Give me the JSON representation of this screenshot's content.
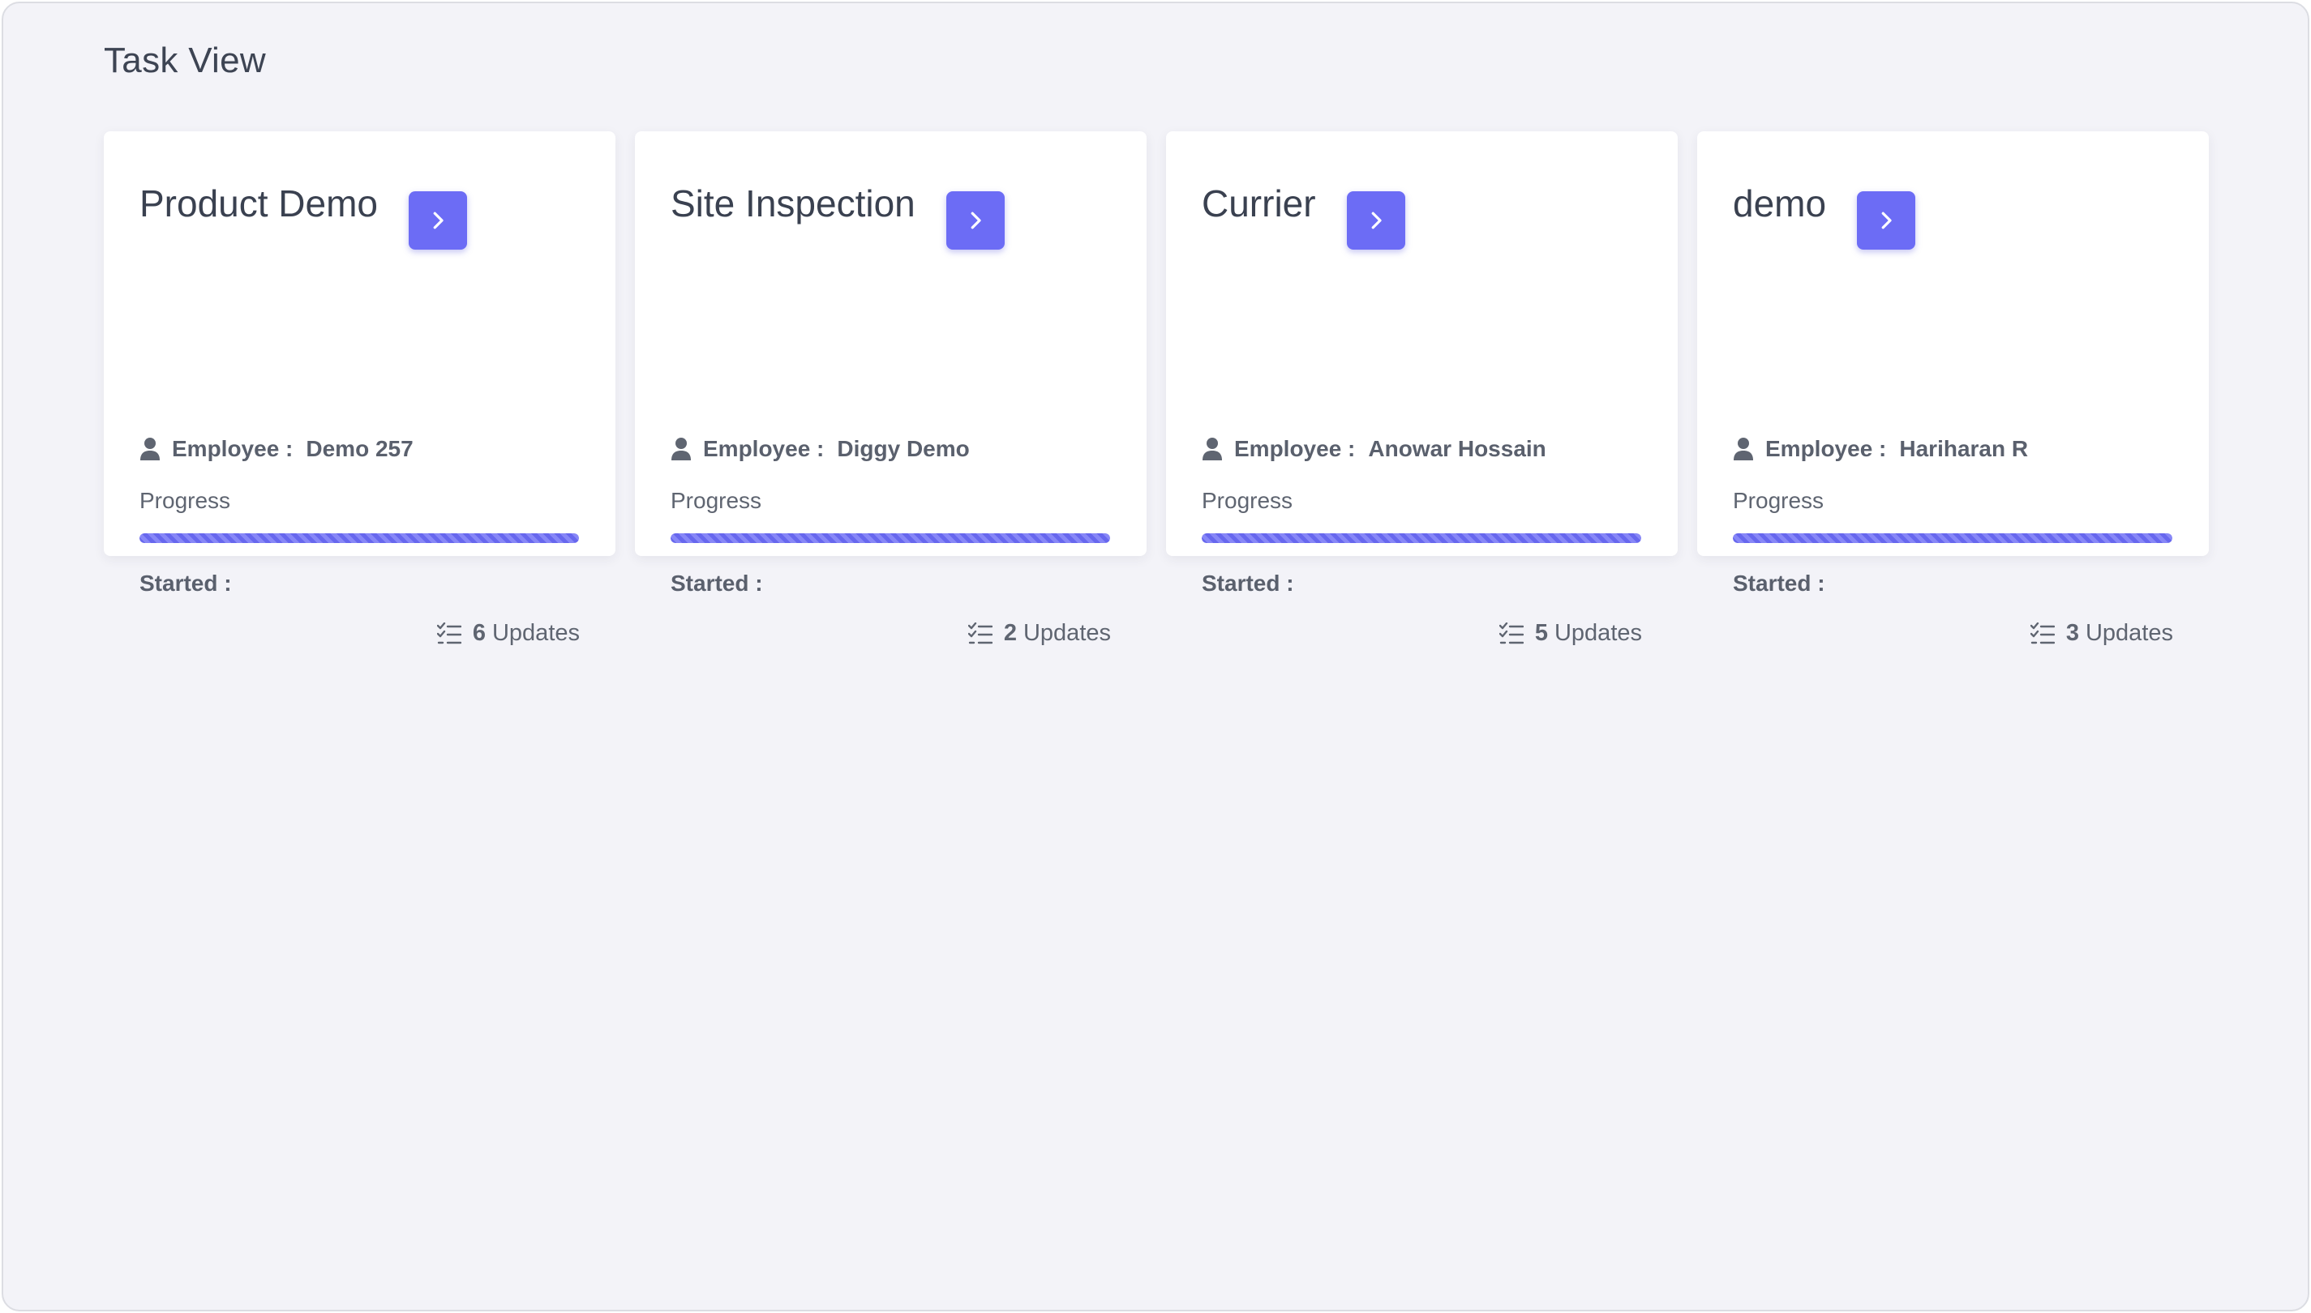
{
  "page": {
    "title": "Task View"
  },
  "colors": {
    "accent": "#6c6cf5",
    "background": "#f3f3f8",
    "card": "#ffffff",
    "text": "#3a4150"
  },
  "cards": [
    {
      "title": "Product Demo",
      "employee_label": "Employee :",
      "employee_name": "Demo 257",
      "progress_label": "Progress",
      "progress_value": 1.0,
      "started_label": "Started :",
      "started_value": "",
      "updates_count": "6",
      "updates_label": "Updates",
      "button_icon": "chevron-right-icon"
    },
    {
      "title": "Site Inspection",
      "employee_label": "Employee :",
      "employee_name": "Diggy Demo",
      "progress_label": "Progress",
      "progress_value": 1.0,
      "started_label": "Started :",
      "started_value": "",
      "updates_count": "2",
      "updates_label": "Updates",
      "button_icon": "chevron-right-icon"
    },
    {
      "title": "Currier",
      "employee_label": "Employee :",
      "employee_name": "Anowar Hossain",
      "progress_label": "Progress",
      "progress_value": 1.0,
      "started_label": "Started :",
      "started_value": "",
      "updates_count": "5",
      "updates_label": "Updates",
      "button_icon": "chevron-right-icon"
    },
    {
      "title": "demo",
      "employee_label": "Employee :",
      "employee_name": "Hariharan R",
      "progress_label": "Progress",
      "progress_value": 1.0,
      "started_label": "Started :",
      "started_value": "",
      "updates_count": "3",
      "updates_label": "Updates",
      "button_icon": "chevron-right-icon"
    }
  ]
}
